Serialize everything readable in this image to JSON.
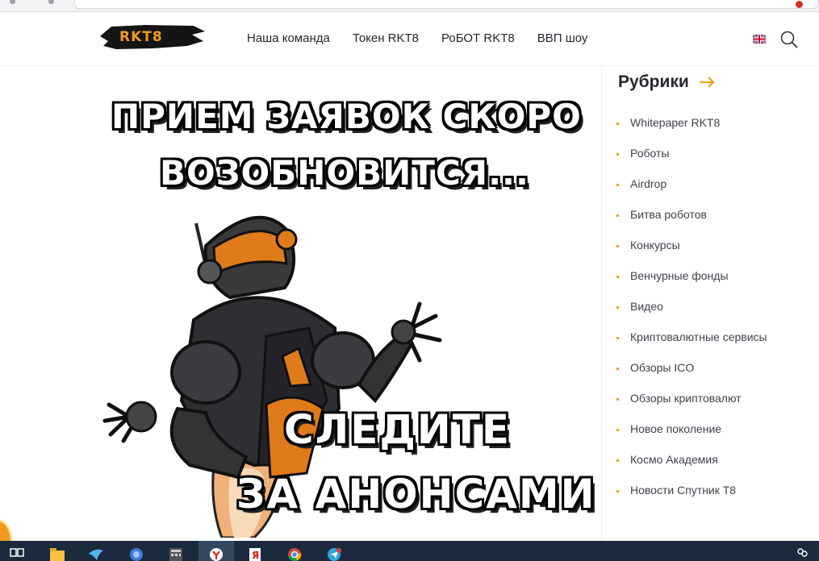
{
  "site": {
    "logo_text": "RKT8",
    "nav": [
      "Наша команда",
      "Токен RKT8",
      "РоБОТ RKT8",
      "ВВП шоу"
    ]
  },
  "banner": {
    "line1": "Прием заявок скоро",
    "line2": "возобновится...",
    "line3": "Следите",
    "line4": "за анонсами"
  },
  "sidebar": {
    "title": "Рубрики",
    "categories": [
      "Whitepaper RKT8",
      "Роботы",
      "Airdrop",
      "Битва роботов",
      "Конкурсы",
      "Венчурные фонды",
      "Видео",
      "Криптовалютные сервисы",
      "Обзоры ICO",
      "Обзоры криптовалют",
      "Новое поколение",
      "Космо Академия",
      "Новости Спутник Т8"
    ]
  },
  "colors": {
    "accent": "#f39a1e",
    "text": "#23272e",
    "taskbar": "#1b2a3c"
  },
  "taskbar": {
    "icons": [
      "task-view-icon",
      "file-explorer-icon",
      "bird-app-icon",
      "game-icon",
      "calculator-icon",
      "yandex-browser-icon",
      "yandex-icon",
      "chrome-icon",
      "telegram-icon",
      "people-icon"
    ]
  }
}
